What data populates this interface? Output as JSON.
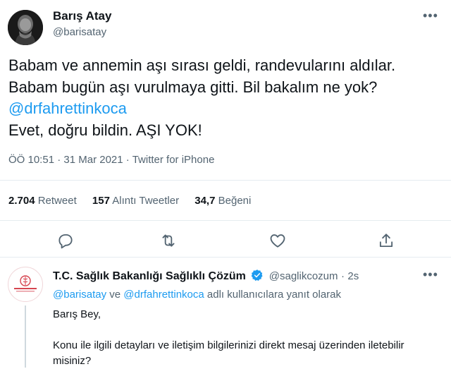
{
  "tweet": {
    "author_name": "Barış Atay",
    "author_handle": "@barisatay",
    "more_icon": "more-horizontal-icon",
    "text_line1": "Babam ve annemin aşı sırası geldi, randevularını aldılar.",
    "text_line2": "Babam bugün aşı vurulmaya gitti. Bil bakalım ne yok?",
    "text_mention": "@drfahrettinkoca",
    "text_line4": "Evet, doğru bildin. AŞI YOK!",
    "time": "ÖÖ 10:51",
    "separator": "·",
    "date": "31 Mar 2021",
    "source": "Twitter for iPhone"
  },
  "stats": {
    "retweets_count": "2.704",
    "retweets_label": "Retweet",
    "quotes_count": "157",
    "quotes_label": "Alıntı Tweetler",
    "likes_count": "34,7",
    "likes_label": "Beğeni"
  },
  "actions": [
    "reply-icon",
    "retweet-icon",
    "like-icon",
    "share-icon"
  ],
  "reply": {
    "author_name": "T.C. Sağlık Bakanlığı Sağlıklı Çözüm",
    "author_handle": "@saglikcozum",
    "time_sep": "·",
    "time": "2s",
    "reply_to_mention1": "@barisatay",
    "reply_to_and": "ve",
    "reply_to_mention2": "@drfahrettinkoca",
    "reply_to_suffix": "adlı kullanıcılara yanıt olarak",
    "greeting": "Barış Bey,",
    "body_line1": "Konu ile ilgili detayları ve iletişim bilgilerinizi direkt mesaj üzerinden iletebilir",
    "body_line2": "misiniz?"
  },
  "colors": {
    "accent": "#1d9bf0",
    "secondary_text": "#536471",
    "primary_text": "#0f1419",
    "divider": "#e6ecf0"
  }
}
